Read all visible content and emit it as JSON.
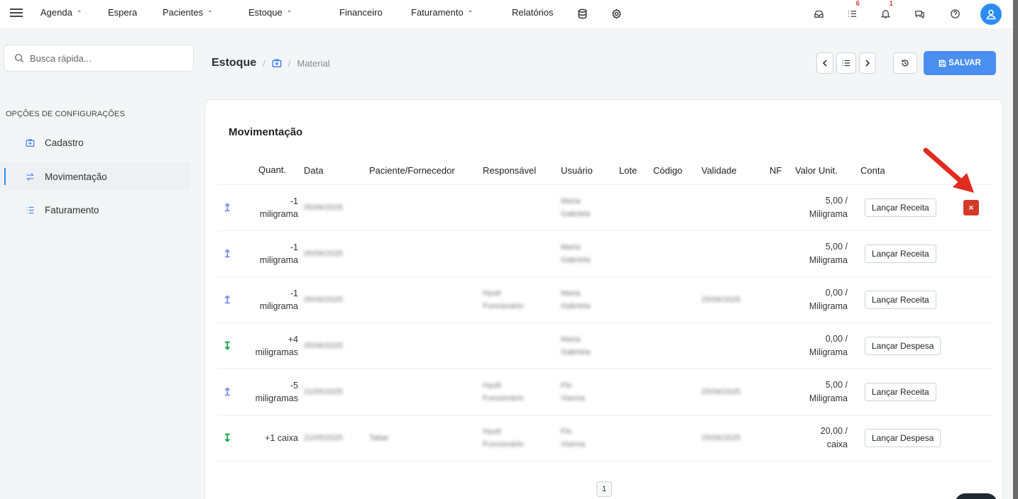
{
  "nav": {
    "items": [
      {
        "label": "Agenda",
        "dropdown": true
      },
      {
        "label": "Espera",
        "dropdown": false
      },
      {
        "label": "Pacientes",
        "dropdown": true
      },
      {
        "label": "Estoque",
        "dropdown": true
      },
      {
        "label": "Financeiro",
        "dropdown": false
      },
      {
        "label": "Faturamento",
        "dropdown": true
      },
      {
        "label": "Relatórios",
        "dropdown": false
      }
    ],
    "tasks_badge": "6",
    "notifications_badge": "1"
  },
  "search": {
    "placeholder": "Busca rápida..."
  },
  "sidebar": {
    "heading": "OPÇÕES DE CONFIGURAÇÕES",
    "items": [
      {
        "label": "Cadastro",
        "icon": "medical-kit-icon"
      },
      {
        "label": "Movimentação",
        "icon": "swap-arrows-icon",
        "active": true
      },
      {
        "label": "Faturamento",
        "icon": "list-icon"
      }
    ]
  },
  "breadcrumb": {
    "main": "Estoque",
    "sep": "/",
    "current": "Material"
  },
  "toolbar": {
    "save_label": "SALVAR"
  },
  "card": {
    "title": "Movimentação",
    "columns": [
      "Quant.",
      "Data",
      "Paciente/Fornecedor",
      "Responsável",
      "Usuário",
      "Lote",
      "Código",
      "Validade",
      "NF",
      "Valor Unit.",
      "Conta"
    ],
    "rows": [
      {
        "dir": "↥",
        "qty1": "-1",
        "qty2": "miligrama",
        "data": "05/06/2025",
        "pac": "",
        "resp1": "",
        "resp2": "",
        "usu1": "Maria",
        "usu2": "Gabriela",
        "validade": "",
        "vu1": "5,00 /",
        "vu2": "Miligrama",
        "action": "Lançar Receita"
      },
      {
        "dir": "↥",
        "qty1": "-1",
        "qty2": "miligrama",
        "data": "05/06/2025",
        "pac": "",
        "resp1": "",
        "resp2": "",
        "usu1": "Maria",
        "usu2": "Gabriela",
        "validade": "",
        "vu1": "5,00 /",
        "vu2": "Miligrama",
        "action": "Lançar Receita"
      },
      {
        "dir": "↥",
        "qty1": "-1",
        "qty2": "miligrama",
        "data": "05/06/2025",
        "pac": "",
        "resp1": "Hyutt",
        "resp2": "Funcionário",
        "usu1": "Maria",
        "usu2": "Gabriela",
        "validade": "25/06/2025",
        "vu1": "0,00 /",
        "vu2": "Miligrama",
        "action": "Lançar Receita"
      },
      {
        "dir": "↧",
        "qty1": "+4",
        "qty2": "miligramas",
        "data": "05/06/2025",
        "pac": "",
        "resp1": "",
        "resp2": "",
        "usu1": "Maria",
        "usu2": "Gabriela",
        "validade": "",
        "vu1": "0,00 /",
        "vu2": "Miligrama",
        "action": "Lançar Despesa"
      },
      {
        "dir": "↥",
        "qty1": "-5",
        "qty2": "miligramas",
        "data": "21/05/2025",
        "pac": "",
        "resp1": "Hyutt",
        "resp2": "Funcionário",
        "usu1": "Flo",
        "usu2": "Vianna",
        "validade": "25/06/2025",
        "vu1": "5,00 /",
        "vu2": "Miligrama",
        "action": "Lançar Receita"
      },
      {
        "dir": "↧",
        "qty1": "+1 caixa",
        "qty2": "",
        "data": "21/05/2025",
        "pac": "Tabar",
        "resp1": "Hyutt",
        "resp2": "Funcionário",
        "usu1": "Flo",
        "usu2": "Vianna",
        "validade": "25/06/2025",
        "vu1": "20,00 /",
        "vu2": "caixa",
        "action": "Lançar Despesa"
      }
    ],
    "delete_label": "×",
    "page": "1"
  },
  "colors": {
    "accent": "#4a8ff0",
    "danger": "#d23b2a",
    "up_arrow": "#7b8cf2",
    "down_arrow": "#16a34a"
  }
}
